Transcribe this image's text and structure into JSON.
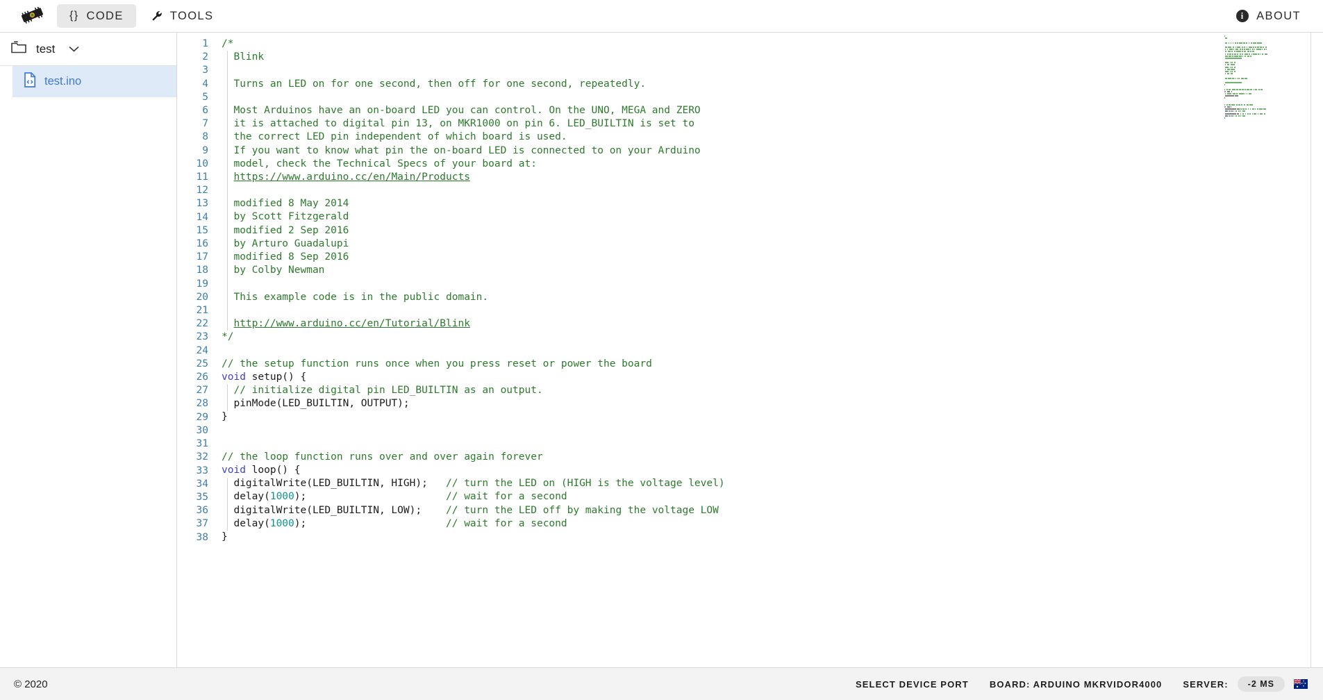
{
  "topbar": {
    "logo_icon": "arduino-board-icon",
    "tabs": [
      {
        "id": "code",
        "label": "CODE",
        "icon": "braces-icon",
        "glyph": "{}",
        "active": true
      },
      {
        "id": "tools",
        "label": "TOOLS",
        "icon": "wrench-icon",
        "glyph": "🔧",
        "active": false
      }
    ],
    "about_label": "ABOUT",
    "about_icon": "info-icon",
    "info_glyph": "i"
  },
  "sidebar": {
    "sketch": {
      "icon": "folder-icon",
      "name": "test",
      "chevron_icon": "chevron-down-icon"
    },
    "files": [
      {
        "icon": "file-code-icon",
        "name": "test.ino",
        "selected": true
      }
    ]
  },
  "editor": {
    "filename": "test.ino",
    "first_line": 1,
    "total_lines": 38,
    "colors": {
      "comment": "#2d7a2d",
      "keyword": "#4040d0",
      "number": "#11948e",
      "text": "#1b1b1b",
      "line_number": "#3f7fa8",
      "selection_bg": "#dfeaf8"
    },
    "lines": [
      {
        "n": 1,
        "tokens": [
          {
            "t": "comment",
            "v": "/*"
          }
        ]
      },
      {
        "n": 2,
        "tokens": [
          {
            "t": "comment",
            "v": "  Blink"
          }
        ]
      },
      {
        "n": 3,
        "tokens": []
      },
      {
        "n": 4,
        "tokens": [
          {
            "t": "comment",
            "v": "  Turns an LED on for one second, then off for one second, repeatedly."
          }
        ]
      },
      {
        "n": 5,
        "tokens": []
      },
      {
        "n": 6,
        "tokens": [
          {
            "t": "comment",
            "v": "  Most Arduinos have an on-board LED you can control. On the UNO, MEGA and ZERO"
          }
        ]
      },
      {
        "n": 7,
        "tokens": [
          {
            "t": "comment",
            "v": "  it is attached to digital pin 13, on MKR1000 on pin 6. LED_BUILTIN is set to"
          }
        ]
      },
      {
        "n": 8,
        "tokens": [
          {
            "t": "comment",
            "v": "  the correct LED pin independent of which board is used."
          }
        ]
      },
      {
        "n": 9,
        "tokens": [
          {
            "t": "comment",
            "v": "  If you want to know what pin the on-board LED is connected to on your Arduino"
          }
        ]
      },
      {
        "n": 10,
        "tokens": [
          {
            "t": "comment",
            "v": "  model, check the Technical Specs of your board at:"
          }
        ]
      },
      {
        "n": 11,
        "tokens": [
          {
            "t": "comment",
            "v": "  "
          },
          {
            "t": "link",
            "v": "https://www.arduino.cc/en/Main/Products"
          }
        ]
      },
      {
        "n": 12,
        "tokens": []
      },
      {
        "n": 13,
        "tokens": [
          {
            "t": "comment",
            "v": "  modified 8 May 2014"
          }
        ]
      },
      {
        "n": 14,
        "tokens": [
          {
            "t": "comment",
            "v": "  by Scott Fitzgerald"
          }
        ]
      },
      {
        "n": 15,
        "tokens": [
          {
            "t": "comment",
            "v": "  modified 2 Sep 2016"
          }
        ]
      },
      {
        "n": 16,
        "tokens": [
          {
            "t": "comment",
            "v": "  by Arturo Guadalupi"
          }
        ]
      },
      {
        "n": 17,
        "tokens": [
          {
            "t": "comment",
            "v": "  modified 8 Sep 2016"
          }
        ]
      },
      {
        "n": 18,
        "tokens": [
          {
            "t": "comment",
            "v": "  by Colby Newman"
          }
        ]
      },
      {
        "n": 19,
        "tokens": []
      },
      {
        "n": 20,
        "tokens": [
          {
            "t": "comment",
            "v": "  This example code is in the public domain."
          }
        ]
      },
      {
        "n": 21,
        "tokens": []
      },
      {
        "n": 22,
        "tokens": [
          {
            "t": "comment",
            "v": "  "
          },
          {
            "t": "link",
            "v": "http://www.arduino.cc/en/Tutorial/Blink"
          }
        ]
      },
      {
        "n": 23,
        "tokens": [
          {
            "t": "comment",
            "v": "*/"
          }
        ]
      },
      {
        "n": 24,
        "tokens": []
      },
      {
        "n": 25,
        "tokens": [
          {
            "t": "comment",
            "v": "// the setup function runs once when you press reset or power the board"
          }
        ]
      },
      {
        "n": 26,
        "tokens": [
          {
            "t": "keyword",
            "v": "void"
          },
          {
            "t": "text",
            "v": " setup() {"
          }
        ]
      },
      {
        "n": 27,
        "tokens": [
          {
            "t": "text",
            "v": "  "
          },
          {
            "t": "comment",
            "v": "// initialize digital pin LED_BUILTIN as an output."
          }
        ]
      },
      {
        "n": 28,
        "tokens": [
          {
            "t": "text",
            "v": "  pinMode(LED_BUILTIN, OUTPUT);"
          }
        ]
      },
      {
        "n": 29,
        "tokens": [
          {
            "t": "text",
            "v": "}"
          }
        ]
      },
      {
        "n": 30,
        "tokens": []
      },
      {
        "n": 31,
        "tokens": []
      },
      {
        "n": 32,
        "tokens": [
          {
            "t": "comment",
            "v": "// the loop function runs over and over again forever"
          }
        ]
      },
      {
        "n": 33,
        "tokens": [
          {
            "t": "keyword",
            "v": "void"
          },
          {
            "t": "text",
            "v": " loop() {"
          }
        ]
      },
      {
        "n": 34,
        "tokens": [
          {
            "t": "text",
            "v": "  digitalWrite(LED_BUILTIN, HIGH);   "
          },
          {
            "t": "comment",
            "v": "// turn the LED on (HIGH is the voltage level)"
          }
        ]
      },
      {
        "n": 35,
        "tokens": [
          {
            "t": "text",
            "v": "  delay("
          },
          {
            "t": "number",
            "v": "1000"
          },
          {
            "t": "text",
            "v": ");                       "
          },
          {
            "t": "comment",
            "v": "// wait for a second"
          }
        ]
      },
      {
        "n": 36,
        "tokens": [
          {
            "t": "text",
            "v": "  digitalWrite(LED_BUILTIN, LOW);    "
          },
          {
            "t": "comment",
            "v": "// turn the LED off by making the voltage LOW"
          }
        ]
      },
      {
        "n": 37,
        "tokens": [
          {
            "t": "text",
            "v": "  delay("
          },
          {
            "t": "number",
            "v": "1000"
          },
          {
            "t": "text",
            "v": ");                       "
          },
          {
            "t": "comment",
            "v": "// wait for a second"
          }
        ]
      },
      {
        "n": 38,
        "tokens": [
          {
            "t": "text",
            "v": "}"
          }
        ]
      }
    ]
  },
  "footer": {
    "copyright": "© 2020",
    "select_device_port": "SELECT DEVICE PORT",
    "board": "BOARD: ARDUINO MKRVIDOR4000",
    "server_label": "SERVER:",
    "latency": "-2 MS",
    "flag_icon": "australia-flag-icon"
  }
}
